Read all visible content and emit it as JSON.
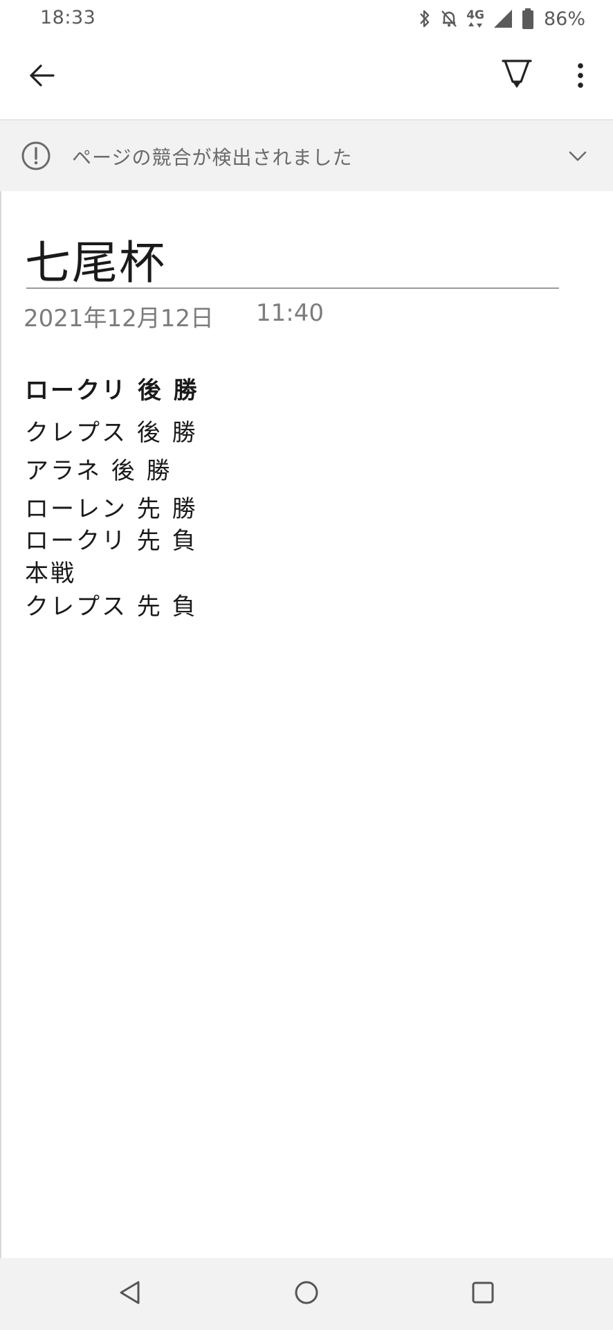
{
  "status_bar": {
    "time": "18:33",
    "network": "4G",
    "battery_percent": "86%",
    "icons": [
      "bluetooth-icon",
      "bell-off-icon",
      "network-4g-icon",
      "signal-icon",
      "battery-icon"
    ]
  },
  "toolbar": {
    "icons": [
      "arrow-left-icon",
      "pen-icon",
      "more-vertical-icon"
    ]
  },
  "banner": {
    "text": "ページの競合が検出されました",
    "icons": [
      "alert-circle-icon",
      "chevron-down-icon"
    ]
  },
  "page": {
    "title": "七尾杯",
    "date": "2021年12月12日",
    "time": "11:40",
    "lines": [
      "ロークリ 後 勝",
      "クレプス 後 勝",
      "アラネ 後 勝",
      "ローレン 先 勝",
      "ロークリ 先 負",
      "本戦",
      "クレプス 先 負"
    ]
  },
  "nav_bar": {
    "icons": [
      "nav-back-icon",
      "nav-home-icon",
      "nav-recents-icon"
    ]
  },
  "colors": {
    "background": "#ffffff",
    "banner_bg": "#f2f2f2",
    "nav_bg": "#f2f2f2",
    "text_primary": "#1a1a1a",
    "text_secondary": "#7c7c7c"
  }
}
